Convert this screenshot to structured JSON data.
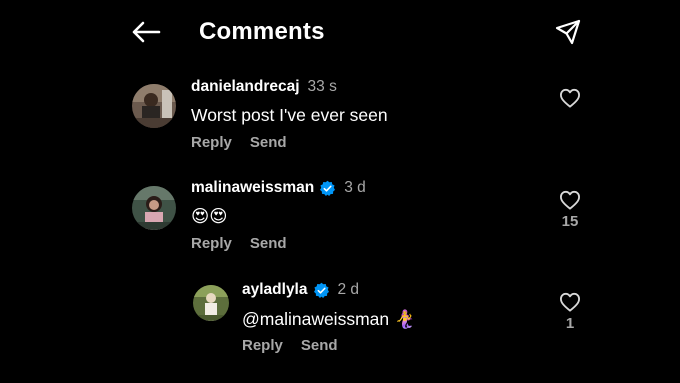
{
  "header": {
    "title": "Comments",
    "back_icon": "arrow-left-icon",
    "share_icon": "paper-plane-icon"
  },
  "comments": [
    {
      "username": "danielandrecaj",
      "verified": false,
      "time": "33 s",
      "text": "Worst post I've ever seen",
      "reply_label": "Reply",
      "send_label": "Send",
      "like_count": ""
    },
    {
      "username": "malinaweissman",
      "verified": true,
      "time": "3 d",
      "text": "😍😍",
      "reply_label": "Reply",
      "send_label": "Send",
      "like_count": "15"
    },
    {
      "username": "ayladlyla",
      "verified": true,
      "time": "2 d",
      "text": "@malinaweissman 🧜‍♀️",
      "reply_label": "Reply",
      "send_label": "Send",
      "like_count": "1"
    }
  ],
  "colors": {
    "background": "#000000",
    "text_primary": "#ffffff",
    "text_secondary": "#a8a8a8",
    "verified_blue": "#0095f6"
  }
}
